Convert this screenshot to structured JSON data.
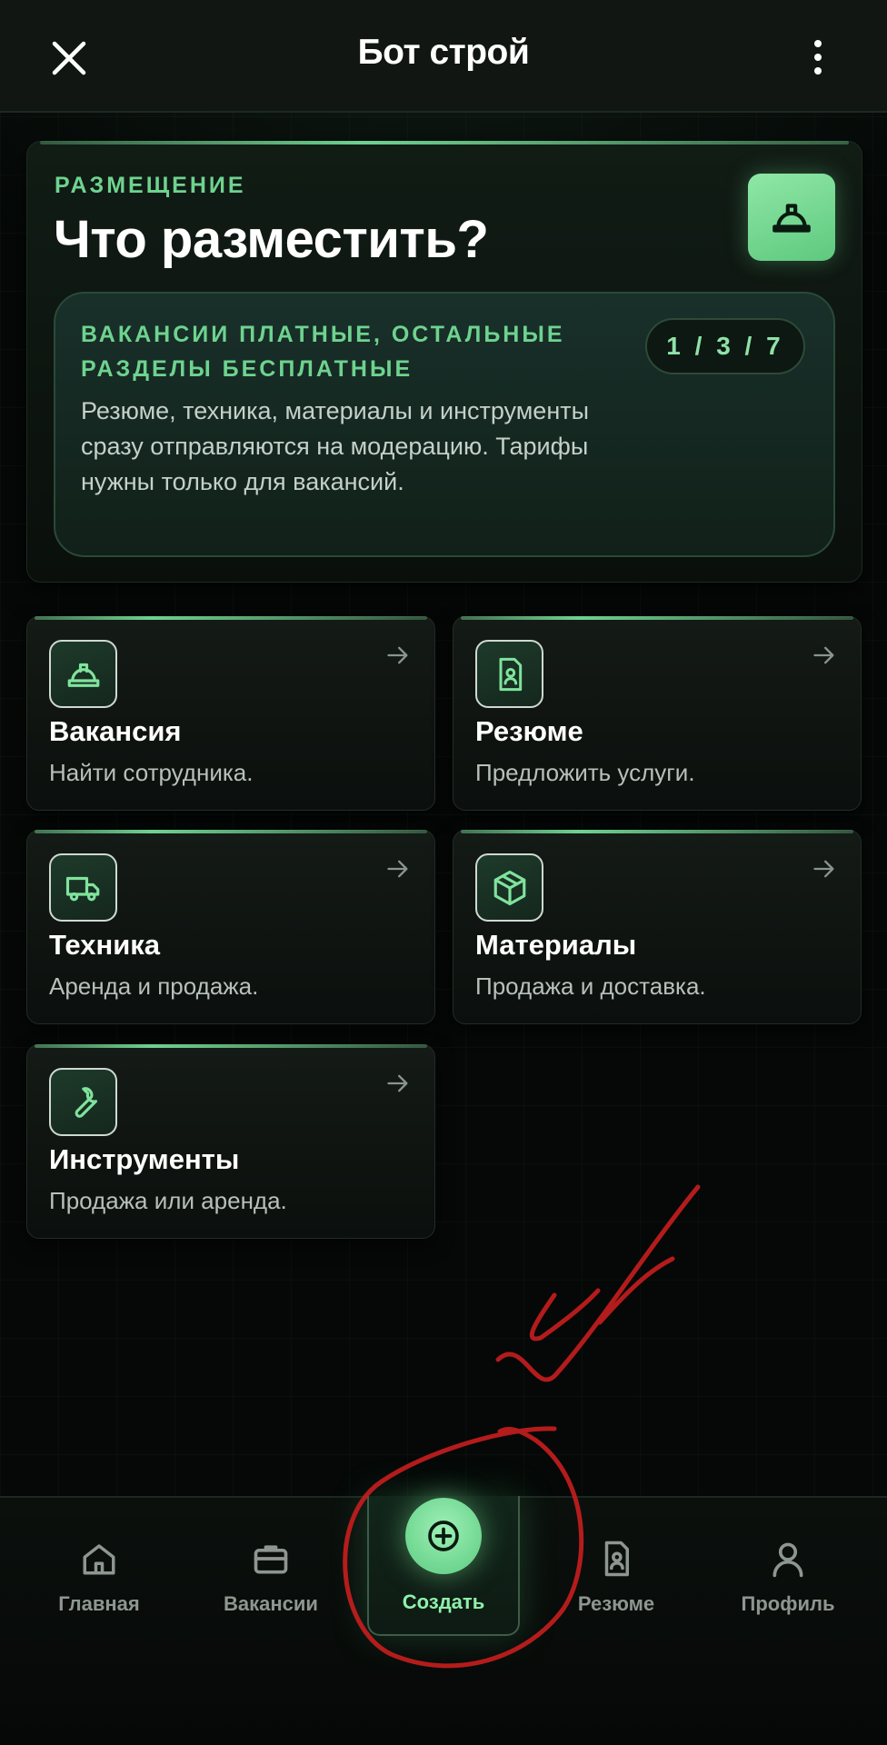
{
  "header": {
    "title": "Бот строй"
  },
  "hero": {
    "kicker": "РАЗМЕЩЕНИЕ",
    "title": "Что разместить?",
    "badge_icon": "hard-hat-icon",
    "notice": {
      "title": "ВАКАНСИИ ПЛАТНЫЕ, ОСТАЛЬНЫЕ РАЗДЕЛЫ БЕСПЛАТНЫЕ",
      "pill": "1 / 3 / 7",
      "body": "Резюме, техника, материалы и инструменты сразу отправляются на модерацию. Тарифы нужны только для вакансий."
    }
  },
  "categories": [
    {
      "title": "Вакансия",
      "subtitle": "Найти сотрудника.",
      "icon": "hard-hat-icon"
    },
    {
      "title": "Резюме",
      "subtitle": "Предложить услуги.",
      "icon": "resume-icon"
    },
    {
      "title": "Техника",
      "subtitle": "Аренда и продажа.",
      "icon": "truck-icon"
    },
    {
      "title": "Материалы",
      "subtitle": "Продажа и доставка.",
      "icon": "box-icon"
    },
    {
      "title": "Инструменты",
      "subtitle": "Продажа или аренда.",
      "icon": "wrench-icon"
    }
  ],
  "nav": {
    "items": [
      {
        "label": "Главная",
        "icon": "home-icon"
      },
      {
        "label": "Вакансии",
        "icon": "briefcase-icon"
      },
      {
        "label": "Создать",
        "icon": "plus-circle-icon",
        "active": true
      },
      {
        "label": "Резюме",
        "icon": "resume-icon"
      },
      {
        "label": "Профиль",
        "icon": "user-icon"
      }
    ]
  },
  "colors": {
    "accent": "#6ed38f",
    "background": "#050707",
    "annotation": "#c81e1e"
  }
}
